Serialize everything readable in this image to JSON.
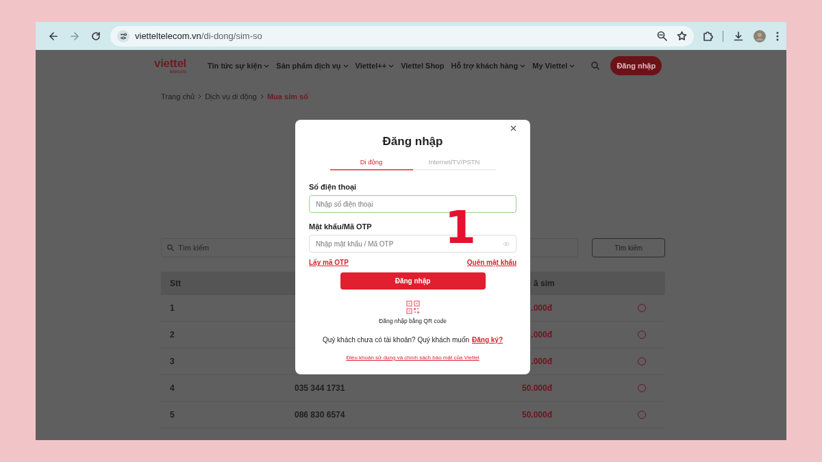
{
  "browser": {
    "url_domain": "vietteltelecom.vn",
    "url_path": "/di-dong/sim-so"
  },
  "nav": {
    "logo": "viettel",
    "logo_sub": "telecom",
    "items": [
      {
        "label": "Tin tức sự kiện",
        "dropdown": true
      },
      {
        "label": "Sản phẩm dịch vụ",
        "dropdown": true
      },
      {
        "label": "Viettel++",
        "dropdown": true
      },
      {
        "label": "Viettel Shop",
        "dropdown": false
      },
      {
        "label": "Hỗ trợ khách hàng",
        "dropdown": true
      },
      {
        "label": "My Viettel",
        "dropdown": true
      }
    ],
    "login_button": "Đăng nhập"
  },
  "breadcrumb": [
    {
      "label": "Trang chủ",
      "current": false
    },
    {
      "label": "Dịch vụ di động",
      "current": false
    },
    {
      "label": "Mua sim số",
      "current": true
    }
  ],
  "search": {
    "placeholder": "Tìm kiếm",
    "button": "Tìm kiếm"
  },
  "table": {
    "columns": [
      "Stt",
      "ã sim"
    ],
    "rows": [
      {
        "stt": "1",
        "price": ".000đ",
        "selected": false
      },
      {
        "stt": "2",
        "price": ".000đ",
        "selected": false
      },
      {
        "stt": "3",
        "price": ".000đ",
        "selected": false
      },
      {
        "stt": "4",
        "number": "035 344 1731",
        "price": "50.000đ",
        "selected": false
      },
      {
        "stt": "5",
        "number": "086 830 6574",
        "price": "50.000đ",
        "selected": false
      }
    ]
  },
  "modal": {
    "title": "Đăng nhập",
    "tabs": [
      {
        "label": "Di động",
        "selected": true
      },
      {
        "label": "Internet/TV/PSTN",
        "selected": false
      }
    ],
    "fields": [
      {
        "label": "Số điện thoại",
        "placeholder": "Nhập số điện thoại",
        "kind": "text",
        "focused": true
      },
      {
        "label": "Mật khẩu/Mã OTP",
        "placeholder": "Nhập mật khẩu / Mã OTP",
        "kind": "password",
        "focused": false
      }
    ],
    "get_otp_link": "Lấy mã OTP",
    "forgot_link": "Quên mật khẩu",
    "submit": "Đăng nhập",
    "qr_label": "Đăng nhập bằng QR code",
    "register_text": "Quý khách chưa có tài khoản? Quý khách muốn",
    "register_link": "Đăng ký?",
    "terms_link": "Điều khoản sử dụng và chính sách bảo mật của Viettel"
  },
  "annotation": "1"
}
